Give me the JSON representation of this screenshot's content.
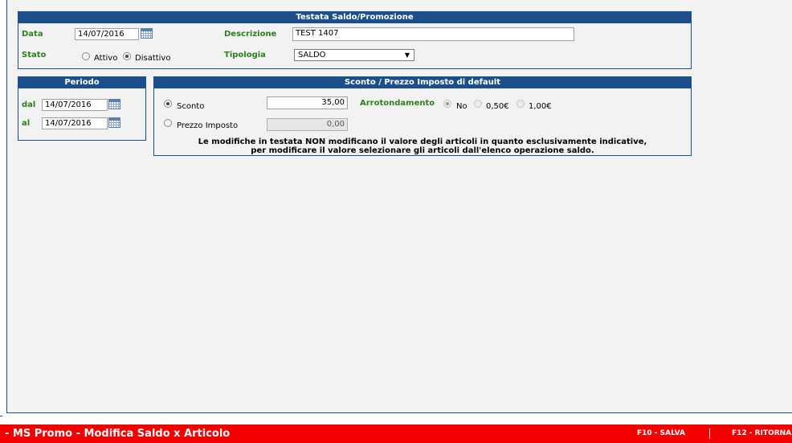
{
  "header_panel": {
    "title": "Testata Saldo/Promozione",
    "data_label": "Data",
    "data_value": "14/07/2016",
    "descrizione_label": "Descrizione",
    "descrizione_value": "TEST 1407",
    "stato_label": "Stato",
    "stato_options": [
      "Attivo",
      "Disattivo"
    ],
    "stato_selected": "Disattivo",
    "tipologia_label": "Tipologia",
    "tipologia_value": "SALDO",
    "tipologia_arrow": "▼"
  },
  "periodo_panel": {
    "title": "Periodo",
    "dal_label": "dal",
    "dal_value": "14/07/2016",
    "al_label": "al",
    "al_value": "14/07/2016"
  },
  "sconto_panel": {
    "title": "Sconto / Prezzo Imposto di default",
    "sconto_label": "Sconto",
    "sconto_value": "35,00",
    "prezzo_label": "Prezzo Imposto",
    "prezzo_value": "0,00",
    "arrotondamento_label": "Arrotondamento",
    "arrotondamento_options": [
      "No",
      "0,50€",
      "1,00€"
    ],
    "arrotondamento_selected": "No",
    "notice_line1": "Le modifiche in testata NON modificano il valore degli articoli in quanto esclusivamente indicative,",
    "notice_line2": "per modificare il valore selezionare gli articoli dall'elenco operazione saldo."
  },
  "footer": {
    "title": "- MS Promo - Modifica Saldo x Articolo",
    "f10_label": "F10 - SALVA",
    "separator": "|",
    "f12_label": "F12 - RITORNA",
    "background_color": "#f20000"
  },
  "colors": {
    "panel_header": "#1a4f8b",
    "label_green": "#2d7f1e"
  },
  "icons": {
    "calendar": "calendar-icon",
    "dropdown": "chevron-down-icon"
  }
}
